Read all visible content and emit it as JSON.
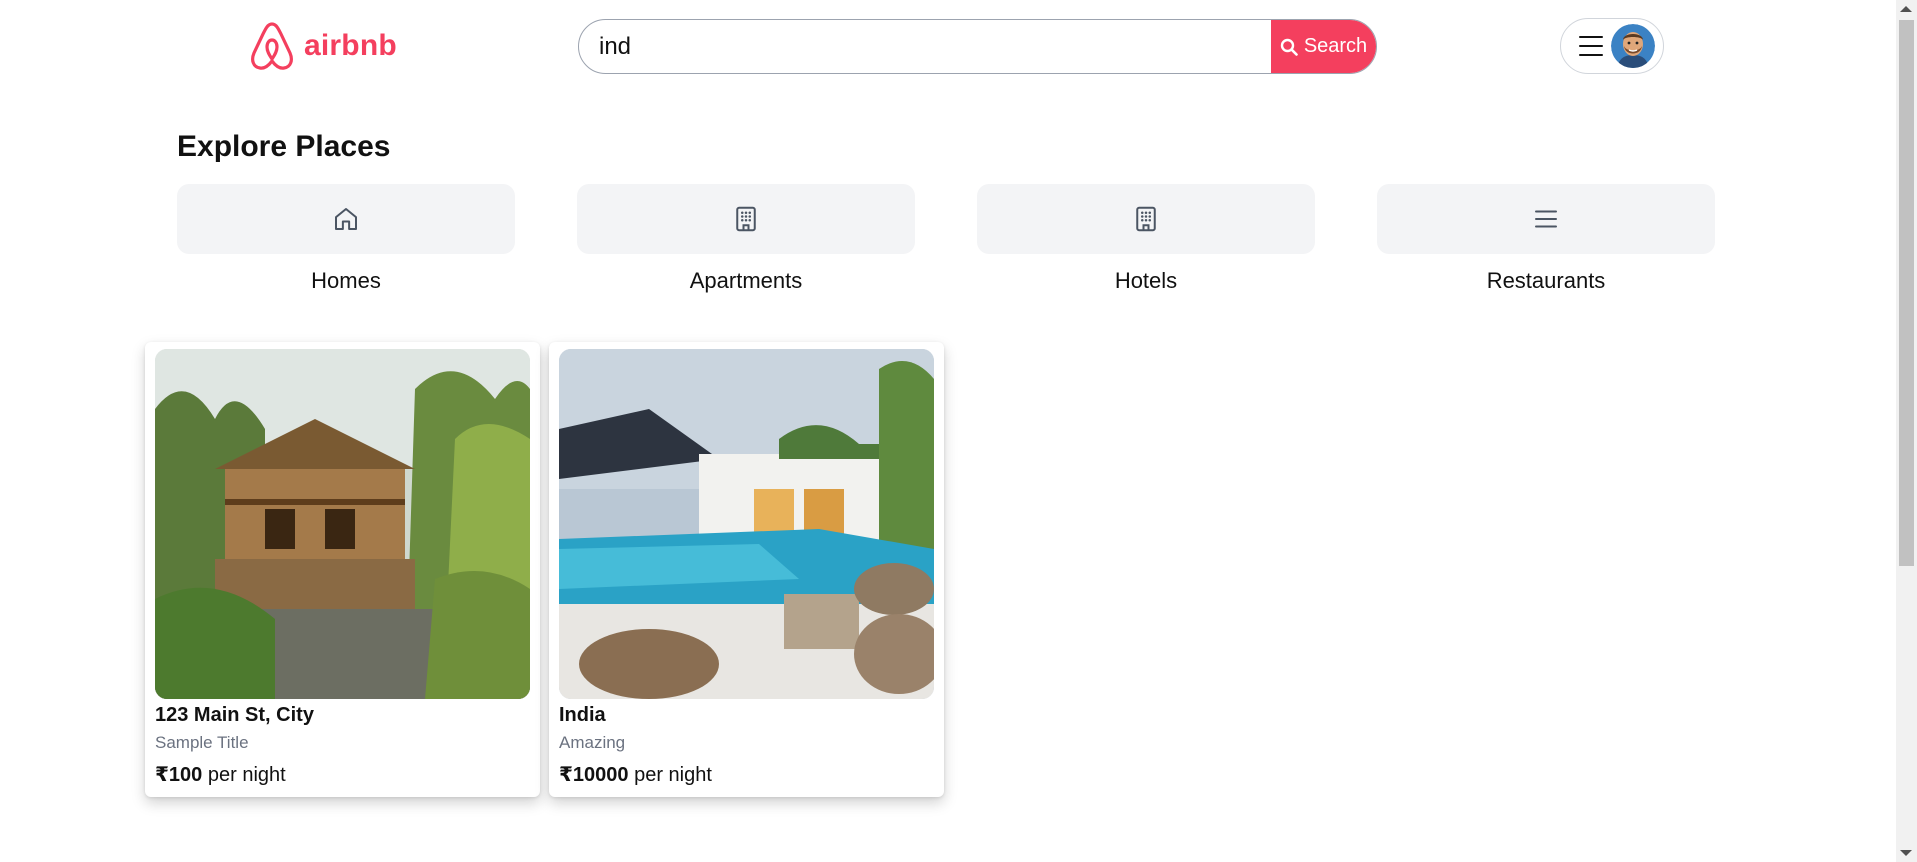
{
  "header": {
    "logo_text": "airbnb",
    "search": {
      "value": "ind",
      "button_label": "Search"
    },
    "brand_color": "#f43f5e"
  },
  "explore": {
    "title": "Explore Places",
    "categories": [
      {
        "label": "Homes",
        "icon": "home-icon"
      },
      {
        "label": "Apartments",
        "icon": "building-icon"
      },
      {
        "label": "Hotels",
        "icon": "building-icon"
      },
      {
        "label": "Restaurants",
        "icon": "menu-lines-icon"
      }
    ]
  },
  "listings": [
    {
      "address": "123 Main St, City",
      "title": "Sample Title",
      "price": "₹100",
      "price_suffix": " per night"
    },
    {
      "address": "India",
      "title": "Amazing",
      "price": "₹10000",
      "price_suffix": " per night"
    }
  ]
}
